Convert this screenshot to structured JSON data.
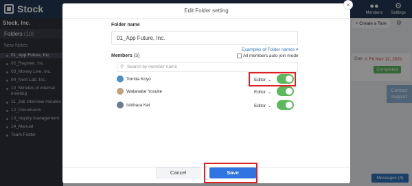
{
  "app": {
    "logo_text": "Stock",
    "org_name": "Stock, Inc.",
    "top_icons": [
      {
        "label": "Members",
        "icon": "members-icon"
      },
      {
        "label": "Settings",
        "icon": "settings-icon"
      }
    ],
    "folders_label": "Folders",
    "folders_count": "(10)",
    "new_notes": "New Notes",
    "folders": [
      "01_App Future, Inc.",
      "02_Register, Inc.",
      "03_Money Line, Inc.",
      "04_Next Lab, Inc.",
      "10_Minutes of internal meeting",
      "11_Job interview minutes",
      "12_Documents",
      "13_Inquiry management",
      "14_Manual",
      "Team Folder"
    ],
    "create_task": "+ Create a Task",
    "due_label": "Due",
    "due_date": "Fri Nov 12, 2021",
    "status": "Completed",
    "contact": "Contact support",
    "messages": "Messages (4)"
  },
  "modal": {
    "title": "Edit Folder setting",
    "folder_name_label": "Folder name",
    "folder_name_value": "01_App Future, Inc.",
    "examples_link": "Examples of Folder names",
    "members_label": "Members",
    "members_count": "(3)",
    "auto_join_label": "All members auto join mode",
    "search_placeholder": "Search by member name",
    "members": [
      {
        "name": "Tomita Koyo",
        "role": "Editor",
        "enabled": true,
        "avatar_color": "#4a90c2"
      },
      {
        "name": "Watanabe Yosuke",
        "role": "Editor",
        "enabled": true,
        "avatar_color": "#c8a07a"
      },
      {
        "name": "Ishihara Kei",
        "role": "Editor",
        "enabled": true,
        "avatar_color": "#6b7c8f"
      }
    ],
    "cancel_label": "Cancel",
    "save_label": "Save"
  },
  "colors": {
    "accent": "#2f74e0",
    "toggle_on": "#5cb85c",
    "highlight": "#e01e26",
    "topbar": "#233954"
  }
}
